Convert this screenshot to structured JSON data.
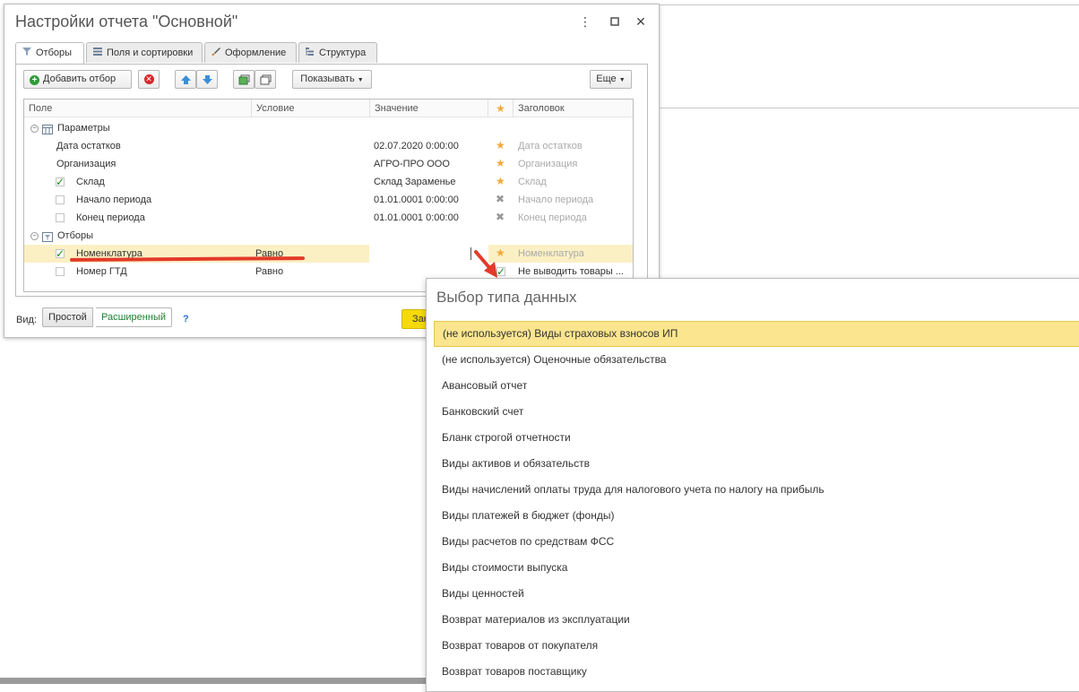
{
  "dialog": {
    "title": "Настройки отчета \"Основной\"",
    "tabs": [
      {
        "label": "Отборы",
        "icon": "filter-icon"
      },
      {
        "label": "Поля и сортировки",
        "icon": "fields-icon"
      },
      {
        "label": "Оформление",
        "icon": "brush-icon"
      },
      {
        "label": "Структура",
        "icon": "structure-icon"
      }
    ],
    "toolbar": {
      "add_filter": "Добавить отбор",
      "show": "Показывать",
      "more": "Еще"
    },
    "columns": [
      "Поле",
      "Условие",
      "Значение",
      "Заголовок"
    ],
    "rows": [
      {
        "field": "Параметры",
        "condition": "",
        "value": "",
        "header": ""
      },
      {
        "field": "Дата остатков",
        "condition": "",
        "value": "02.07.2020 0:00:00",
        "header": "Дата остатков"
      },
      {
        "field": "Организация",
        "condition": "",
        "value": "АГРО-ПРО ООО",
        "header": "Организация"
      },
      {
        "field": "Склад",
        "condition": "",
        "value": "Склад Зараменье",
        "header": "Склад"
      },
      {
        "field": "Начало периода",
        "condition": "",
        "value": "01.01.0001 0:00:00",
        "header": "Начало периода"
      },
      {
        "field": "Конец периода",
        "condition": "",
        "value": "01.01.0001 0:00:00",
        "header": "Конец периода"
      },
      {
        "field": "Отборы",
        "condition": "",
        "value": "",
        "header": ""
      },
      {
        "field": "Номенклатура",
        "condition": "Равно",
        "value": "",
        "header": "Номенклатура"
      },
      {
        "field": "Номер ГТД",
        "condition": "Равно",
        "value": "",
        "header": "Не выводить товары ..."
      }
    ],
    "footer": {
      "view_label": "Вид:",
      "simple": "Простой",
      "extended": "Расширенный",
      "help": "?",
      "ok_label": "Зак"
    }
  },
  "popup": {
    "title": "Выбор типа данных",
    "items": [
      "(не используется) Виды страховых взносов ИП",
      "(не используется) Оценочные обязательства",
      "Авансовый отчет",
      "Банковский счет",
      "Бланк строгой отчетности",
      "Виды активов и обязательств",
      "Виды начислений оплаты труда для налогового учета по налогу на прибыль",
      "Виды платежей в бюджет (фонды)",
      "Виды расчетов по средствам ФСС",
      "Виды стоимости выпуска",
      "Виды ценностей",
      "Возврат материалов из эксплуатации",
      "Возврат товаров от покупателя",
      "Возврат товаров поставщику"
    ]
  },
  "colors": {
    "accent_yellow": "#f5d90a",
    "selection": "#fbe58f",
    "annotation_red": "#e33a2a",
    "star": "#f2a93b"
  }
}
